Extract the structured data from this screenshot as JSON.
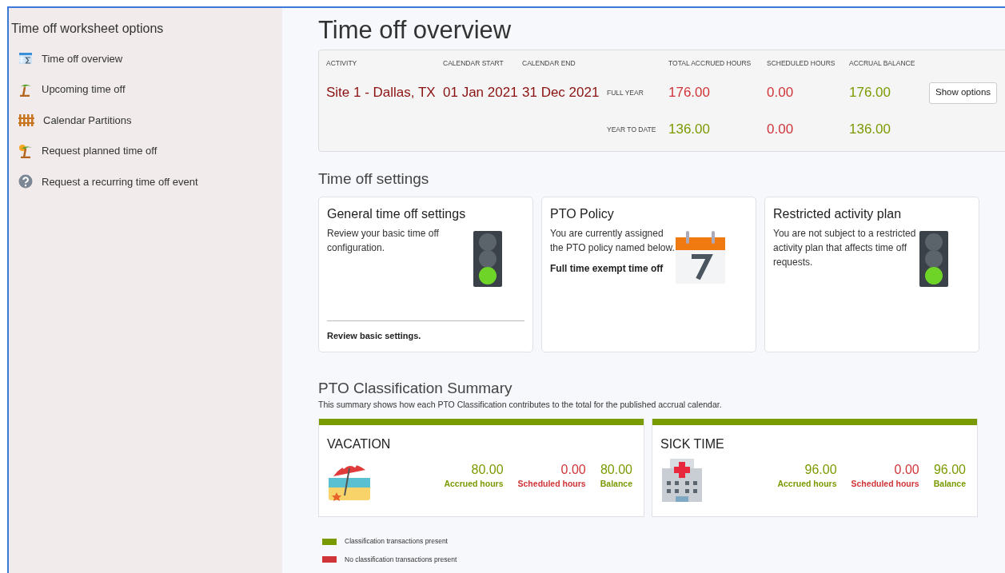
{
  "sidebar": {
    "title": "Time off worksheet options",
    "items": [
      {
        "label": "Time off overview",
        "kind": "sheet"
      },
      {
        "label": "Upcoming time off",
        "kind": "palm"
      },
      {
        "label": "Calendar Partitions",
        "kind": "fence"
      },
      {
        "label": "Request planned time off",
        "kind": "sunpalm"
      },
      {
        "label": "Request a recurring time off event",
        "kind": "help"
      }
    ]
  },
  "overview": {
    "title": "Time off overview",
    "columns": [
      "ACTIVITY",
      "CALENDAR START",
      "CALENDAR END",
      "TOTAL ACCRUED HOURS",
      "SCHEDULED HOURS",
      "ACCRUAL BALANCE"
    ],
    "activity": "Site 1 - Dallas, TX",
    "calendar_start": "01 Jan 2021",
    "calendar_end": "31 Dec 2021",
    "rows": [
      {
        "label": "FULL YEAR",
        "values": [
          {
            "text": "176.00",
            "color": "#d13438"
          },
          {
            "text": "0.00",
            "color": "#d13438"
          },
          {
            "text": "176.00",
            "color": "#7a9a01"
          }
        ]
      },
      {
        "label": "YEAR TO DATE",
        "values": [
          {
            "text": "136.00",
            "color": "#7a9a01"
          },
          {
            "text": "0.00",
            "color": "#d13438"
          },
          {
            "text": "136.00",
            "color": "#7a9a01"
          }
        ]
      }
    ],
    "button": "Show options"
  },
  "settings": {
    "title": "Time off settings",
    "cards": [
      {
        "title": "General time off settings",
        "text": "Review your basic time off configuration.",
        "kind": "signal",
        "footer": "Review basic settings."
      },
      {
        "title": "PTO Policy",
        "text": "You are currently assigned the PTO policy named below.",
        "bold_text": "Full time exempt time off",
        "kind": "calendar"
      },
      {
        "title": "Restricted activity plan",
        "text": "You are not subject to a restricted activity plan that affects time off requests.",
        "kind": "signal"
      }
    ]
  },
  "summary": {
    "title": "PTO Classification Summary",
    "description": "This summary shows how each PTO Classification contributes to the total for the published accrual calendar.",
    "cards": [
      {
        "title": "VACATION",
        "kind": "beach",
        "color": "#7a9a01",
        "stats": [
          {
            "value": "80.00",
            "label": "Accrued hours",
            "color": "#7a9a01"
          },
          {
            "value": "0.00",
            "label": "Scheduled hours",
            "color": "#d13438"
          },
          {
            "value": "80.00",
            "label": "Balance",
            "color": "#7a9a01"
          }
        ]
      },
      {
        "title": "SICK TIME",
        "kind": "hospital",
        "color": "#7a9a01",
        "stats": [
          {
            "value": "96.00",
            "label": "Accrued hours",
            "color": "#7a9a01"
          },
          {
            "value": "0.00",
            "label": "Scheduled hours",
            "color": "#d13438"
          },
          {
            "value": "96.00",
            "label": "Balance",
            "color": "#7a9a01"
          }
        ]
      }
    ],
    "legend": [
      {
        "label": "Classification transactions present",
        "color": "#7a9a01"
      },
      {
        "label": "No classification transactions present",
        "color": "#d13438"
      }
    ]
  }
}
